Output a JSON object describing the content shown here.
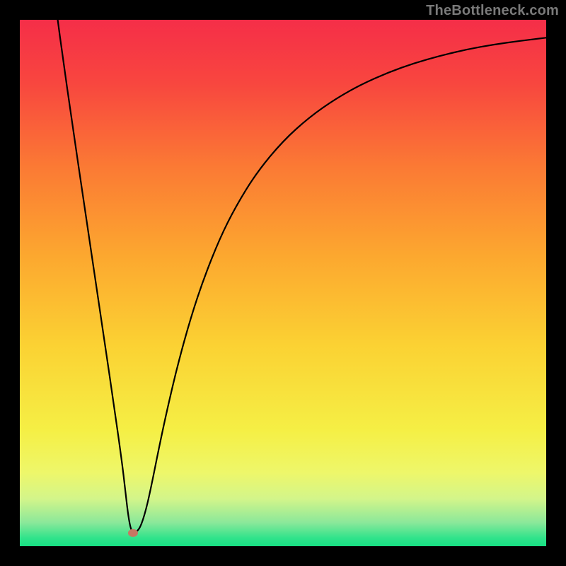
{
  "watermark": "TheBottleneck.com",
  "chart_data": {
    "type": "line",
    "title": "",
    "xlabel": "",
    "ylabel": "",
    "xlim": [
      0,
      100
    ],
    "ylim": [
      0,
      100
    ],
    "background_gradient": {
      "stops": [
        {
          "offset": 0.0,
          "color": "#f52e48"
        },
        {
          "offset": 0.12,
          "color": "#f8463f"
        },
        {
          "offset": 0.28,
          "color": "#fb7a34"
        },
        {
          "offset": 0.45,
          "color": "#fca82f"
        },
        {
          "offset": 0.62,
          "color": "#fbd233"
        },
        {
          "offset": 0.78,
          "color": "#f5ef45"
        },
        {
          "offset": 0.86,
          "color": "#eef76a"
        },
        {
          "offset": 0.91,
          "color": "#d3f58a"
        },
        {
          "offset": 0.955,
          "color": "#8be89a"
        },
        {
          "offset": 0.985,
          "color": "#2fe38b"
        },
        {
          "offset": 1.0,
          "color": "#17e083"
        }
      ]
    },
    "minPoint": {
      "x": 21.5,
      "y": 2.5,
      "color": "#c77763"
    },
    "series": [
      {
        "name": "curve",
        "color": "#000000",
        "width": 2.2,
        "points": [
          {
            "x": 7.2,
            "y": 100.0
          },
          {
            "x": 8.0,
            "y": 94.0
          },
          {
            "x": 10.0,
            "y": 80.0
          },
          {
            "x": 12.0,
            "y": 66.5
          },
          {
            "x": 14.0,
            "y": 53.0
          },
          {
            "x": 16.0,
            "y": 39.5
          },
          {
            "x": 18.0,
            "y": 26.0
          },
          {
            "x": 19.4,
            "y": 16.0
          },
          {
            "x": 20.0,
            "y": 11.0
          },
          {
            "x": 20.5,
            "y": 6.5
          },
          {
            "x": 21.0,
            "y": 3.5
          },
          {
            "x": 21.5,
            "y": 2.5
          },
          {
            "x": 22.2,
            "y": 2.7
          },
          {
            "x": 23.0,
            "y": 3.8
          },
          {
            "x": 24.0,
            "y": 7.0
          },
          {
            "x": 25.0,
            "y": 11.5
          },
          {
            "x": 26.5,
            "y": 19.0
          },
          {
            "x": 28.0,
            "y": 26.0
          },
          {
            "x": 30.0,
            "y": 34.5
          },
          {
            "x": 32.5,
            "y": 43.5
          },
          {
            "x": 35.0,
            "y": 51.0
          },
          {
            "x": 38.0,
            "y": 58.5
          },
          {
            "x": 41.0,
            "y": 64.5
          },
          {
            "x": 45.0,
            "y": 71.0
          },
          {
            "x": 50.0,
            "y": 77.0
          },
          {
            "x": 55.0,
            "y": 81.5
          },
          {
            "x": 60.0,
            "y": 85.0
          },
          {
            "x": 65.0,
            "y": 87.8
          },
          {
            "x": 70.0,
            "y": 90.0
          },
          {
            "x": 75.0,
            "y": 91.8
          },
          {
            "x": 80.0,
            "y": 93.2
          },
          {
            "x": 85.0,
            "y": 94.4
          },
          {
            "x": 90.0,
            "y": 95.3
          },
          {
            "x": 95.0,
            "y": 96.0
          },
          {
            "x": 100.0,
            "y": 96.6
          }
        ]
      }
    ]
  }
}
